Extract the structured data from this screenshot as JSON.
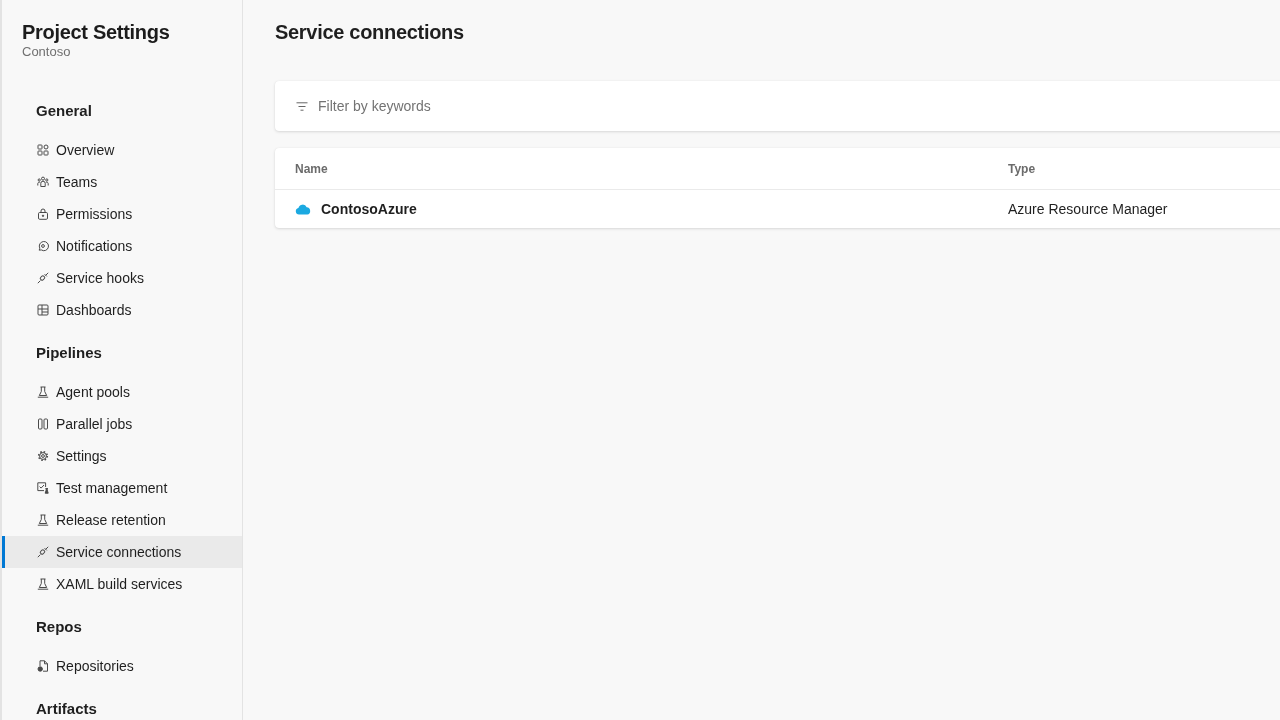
{
  "sidebar": {
    "title": "Project Settings",
    "subtitle": "Contoso",
    "groups": [
      {
        "heading": "General",
        "items": [
          {
            "label": "Overview",
            "selected": false
          },
          {
            "label": "Teams",
            "selected": false
          },
          {
            "label": "Permissions",
            "selected": false
          },
          {
            "label": "Notifications",
            "selected": false
          },
          {
            "label": "Service hooks",
            "selected": false
          },
          {
            "label": "Dashboards",
            "selected": false
          }
        ]
      },
      {
        "heading": "Pipelines",
        "items": [
          {
            "label": "Agent pools",
            "selected": false
          },
          {
            "label": "Parallel jobs",
            "selected": false
          },
          {
            "label": "Settings",
            "selected": false
          },
          {
            "label": "Test management",
            "selected": false
          },
          {
            "label": "Release retention",
            "selected": false
          },
          {
            "label": "Service connections",
            "selected": true
          },
          {
            "label": "XAML build services",
            "selected": false
          }
        ]
      },
      {
        "heading": "Repos",
        "items": [
          {
            "label": "Repositories",
            "selected": false
          }
        ]
      },
      {
        "heading": "Artifacts"
      }
    ]
  },
  "main": {
    "title": "Service connections",
    "filter": {
      "placeholder": "Filter by keywords"
    },
    "table": {
      "columns": [
        "Name",
        "Type"
      ],
      "rows": [
        {
          "name": "ContosoAzure",
          "type": "Azure Resource Manager"
        }
      ]
    }
  }
}
